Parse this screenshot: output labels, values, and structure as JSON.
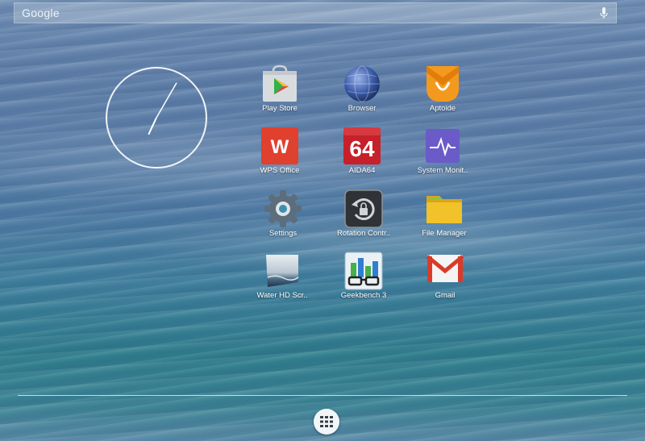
{
  "search": {
    "logo_text": "Google",
    "mic_icon": "microphone-icon"
  },
  "clock": {
    "hour_angle_deg": 205,
    "minute_angle_deg": 30,
    "icon": "analog-clock"
  },
  "apps": [
    {
      "label": "Play Store",
      "icon": "play-store-icon"
    },
    {
      "label": "Browser",
      "icon": "globe-icon"
    },
    {
      "label": "Aptoide",
      "icon": "aptoide-icon"
    },
    {
      "label": "WPS Office",
      "icon": "wps-office-icon"
    },
    {
      "label": "AIDA64",
      "icon": "aida64-icon"
    },
    {
      "label": "System Monit..",
      "icon": "system-monitor-icon"
    },
    {
      "label": "Settings",
      "icon": "settings-gear-icon"
    },
    {
      "label": "Rotation Contr..",
      "icon": "rotation-lock-icon"
    },
    {
      "label": "File Manager",
      "icon": "folder-icon"
    },
    {
      "label": "Water HD Scr..",
      "icon": "water-screenshot-icon"
    },
    {
      "label": "Geekbench 3",
      "icon": "geekbench-icon"
    },
    {
      "label": "Gmail",
      "icon": "gmail-icon"
    }
  ],
  "icon_text": {
    "aida64": "64",
    "wps": "W"
  },
  "dock": {
    "all_apps_icon": "app-drawer-icon"
  },
  "colors": {
    "wps_red": "#e0402e",
    "aida_red": "#c6202a",
    "aptoide_orange": "#f39a1e",
    "monitor_purple": "#6a5bc9",
    "folder_yellow": "#f2c22a",
    "gmail_red": "#d93b2b"
  }
}
